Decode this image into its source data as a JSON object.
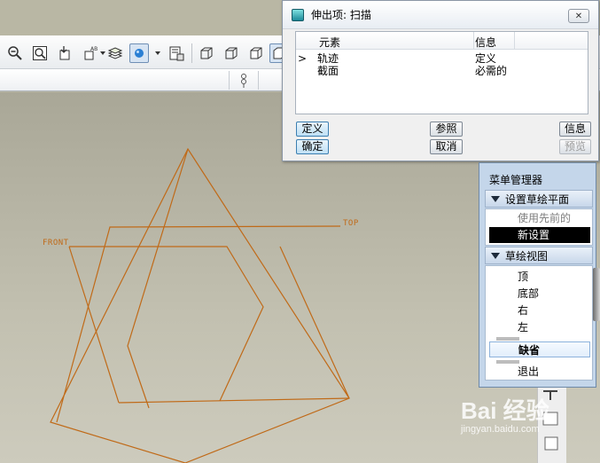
{
  "dialog": {
    "title": "伸出项: 扫描",
    "close_glyph": "✕",
    "columns": {
      "element": "元素",
      "info": "信息"
    },
    "rows": [
      {
        "marker": ">",
        "element": "轨迹",
        "info": "定义"
      },
      {
        "marker": "",
        "element": "截面",
        "info": "必需的"
      }
    ],
    "buttons": {
      "define": "定义",
      "refs": "参照",
      "info": "信息",
      "ok": "确定",
      "cancel": "取消",
      "preview": "预览"
    }
  },
  "menu_manager": {
    "title": "菜单管理器",
    "section1": {
      "header": "设置草绘平面",
      "items": [
        "使用先前的",
        "新设置"
      ]
    },
    "section2": {
      "header": "草绘视图",
      "items": [
        "顶",
        "底部",
        "右",
        "左",
        "缺省",
        "退出"
      ]
    }
  },
  "canvas": {
    "plane_labels": {
      "front": "FRONT",
      "top": "TOP"
    },
    "sketch_color": "#c06a18"
  },
  "watermark": {
    "brand": "Bai 经验",
    "url": "jingyan.baidu.com"
  },
  "colors": {
    "menu_bg": "#c4d6ea",
    "selected_item": "#000000",
    "default_button": "#bfe0f5"
  }
}
